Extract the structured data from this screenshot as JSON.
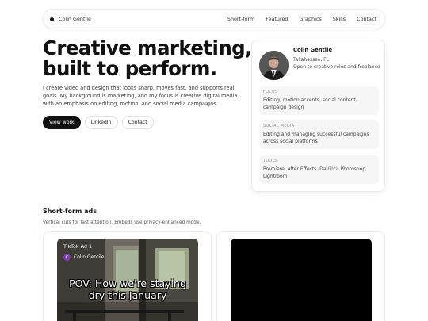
{
  "nav": {
    "brand": "Colin Gentile",
    "links": [
      "Short-form",
      "Featured",
      "Graphics",
      "Skills",
      "Contact"
    ]
  },
  "hero": {
    "title_line1": "Creative marketing,",
    "title_line2": "built to perform.",
    "description": "I create video and design that looks sharp, moves fast, and supports real goals. My background is marketing, and my focus is creative digital media with an emphasis on editing, motion, and social media campaigns.",
    "buttons": {
      "view_work": "View work",
      "linkedin": "LinkedIn",
      "contact": "Contact"
    }
  },
  "profile": {
    "name": "Colin Gentile",
    "location": "Tallahassee, FL",
    "status": "Open to creative roles and freelance",
    "focus": {
      "label": "FOCUS",
      "text": "Editing, motion accents, social content, campaign design"
    },
    "social_media": {
      "label": "SOCIAL MEDIA",
      "text": "Editing and managing successful campaigns across social platforms"
    },
    "tools": {
      "label": "TOOLS",
      "text": "Premiere, After Effects, DaVinci, Photoshop, Lightroom"
    }
  },
  "shortform": {
    "title": "Short-form ads",
    "subtitle": "Vertical cuts for fast attention. Embeds use privacy-enhanced mode.",
    "videos": [
      {
        "title": "TikTok Ad 1",
        "author_initial": "C",
        "author": "Colin Gentile",
        "caption_line1": "POV: How we're staying",
        "caption_line2": "dry this January"
      }
    ]
  },
  "colors": {
    "accent": "#111111",
    "text_muted": "#555555",
    "card_border": "#ececec",
    "info_bg": "#f6f6f6",
    "avatar_purple": "#7a3fb8"
  },
  "icons": {
    "brand_dot": "brand-dot-icon"
  }
}
